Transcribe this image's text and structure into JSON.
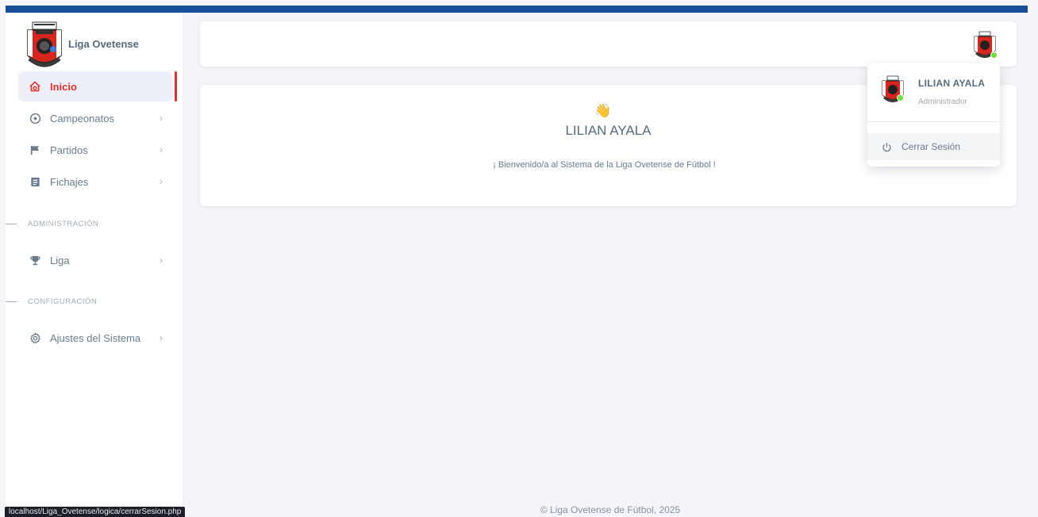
{
  "app": {
    "brand_name": "Liga Ovetense",
    "accent_color": "#e0302e",
    "topbar_color": "#174d99"
  },
  "sidebar": {
    "items": [
      {
        "label": "Inicio",
        "icon": "home-icon",
        "active": true
      },
      {
        "label": "Campeonatos",
        "icon": "plus-circle-icon",
        "has_submenu": true
      },
      {
        "label": "Partidos",
        "icon": "flag-icon",
        "has_submenu": true
      },
      {
        "label": "Fichajes",
        "icon": "document-icon",
        "has_submenu": true
      }
    ],
    "section_admin": "ADMINISTRACIÓN",
    "admin_items": [
      {
        "label": "Liga",
        "icon": "trophy-icon",
        "has_submenu": true
      }
    ],
    "section_config": "CONFIGURACIÓN",
    "config_items": [
      {
        "label": "Ajustes del Sistema",
        "icon": "gear-icon",
        "has_submenu": true
      }
    ]
  },
  "welcome": {
    "emoji": "👋",
    "name": "LILIAN AYALA",
    "message": "¡ Bienvenido/a al Sistema de la Liga Ovetense de Fútbol !"
  },
  "user_menu": {
    "name": "LILIAN AYALA",
    "role": "Administrador",
    "logout_label": "Cerrar Sesión"
  },
  "footer": {
    "text": "© Liga Ovetense de Fútbol, 2025"
  },
  "statusbar": {
    "url": "localhost/Liga_Ovetense/logica/cerrarSesion.php"
  }
}
